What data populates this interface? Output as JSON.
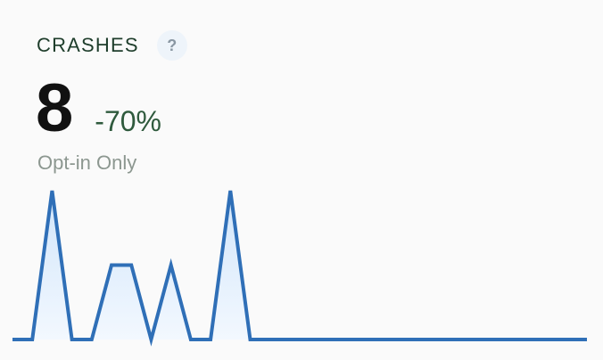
{
  "card": {
    "title": "CRASHES",
    "help_icon_label": "?",
    "value": "8",
    "change": "-70%",
    "subtitle": "Opt-in Only"
  },
  "chart_data": {
    "type": "area",
    "series": [
      {
        "values": [
          0,
          0,
          4,
          0,
          0,
          2,
          2,
          0,
          2,
          0,
          0,
          4,
          0,
          0,
          0,
          0,
          0,
          0,
          0,
          0,
          0,
          0,
          0,
          0,
          0,
          0,
          0,
          0,
          0,
          0
        ]
      }
    ],
    "grid": false,
    "legend": "none",
    "line_color": "#2f6fb7",
    "fill_color": "#dcecfb"
  }
}
